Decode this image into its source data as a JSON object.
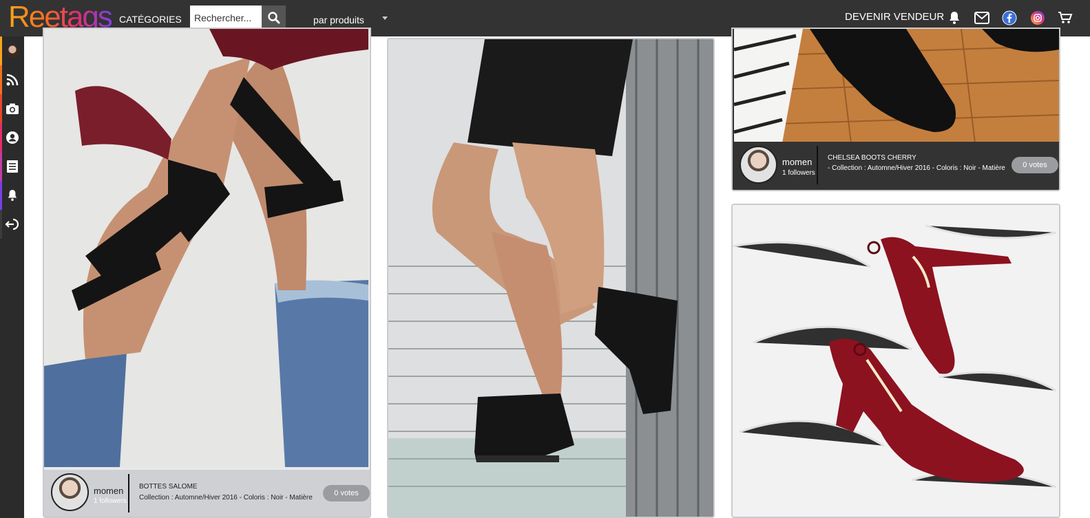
{
  "header": {
    "logo": "Reetags",
    "categories": "CATÉGORIES",
    "search_placeholder": "Rechercher...",
    "filter": "par produits",
    "become_seller": "DEVENIR VENDEUR"
  },
  "sidebar": {
    "items": [
      "avatar",
      "rss-icon",
      "camera-icon",
      "user-icon",
      "list-icon",
      "bell-icon",
      "logout-icon"
    ],
    "accent_colors": [
      "#f7a51c",
      "#f37021",
      "#e52d6e",
      "#c03fa0",
      "#7b3fe4"
    ]
  },
  "cards": [
    {
      "username": "momen",
      "followers": "1 followers",
      "title": "BOTTES SALOME",
      "desc": "Collection : Automne/Hiver 2016 - Coloris : Noir - Matière",
      "votes": "0 votes"
    },
    {
      "username": "momen",
      "followers": "1 followers",
      "title": "CHELSEA BOOTS CHERRY",
      "desc": "- Collection : Automne/Hiver 2016 - Coloris : Noir - Matière",
      "votes": "0 votes"
    }
  ],
  "colors": {
    "topbar": "#333333",
    "sidebar": "#2b2b2b",
    "votes_pill": "#9a9ca0"
  }
}
